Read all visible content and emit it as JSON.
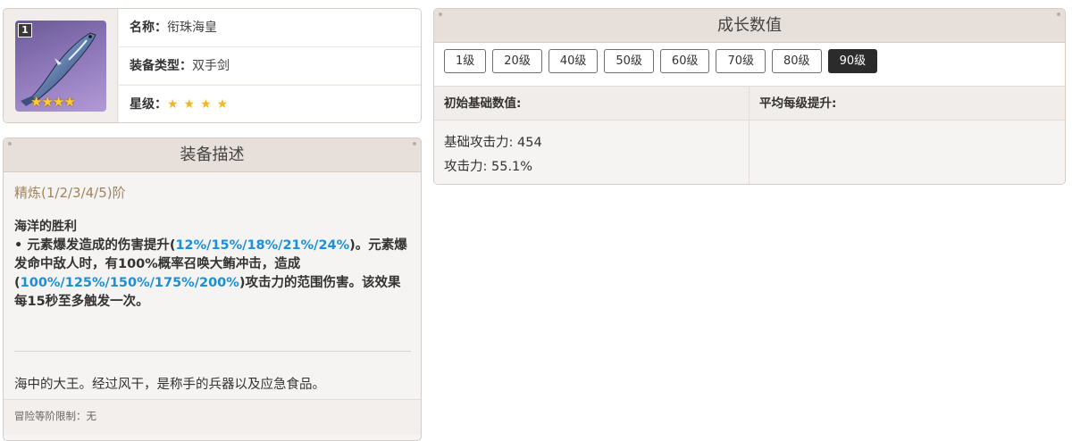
{
  "weapon": {
    "refine_badge": "1",
    "stars_icon": "★★★★",
    "name_label": "名称：",
    "name": "衔珠海皇",
    "type_label": "装备类型：",
    "type": "双手剑",
    "star_label": "星级：",
    "stars": "★★★★",
    "rarity": 4
  },
  "description": {
    "header": "装备描述",
    "refine": "精炼(1/2/3/4/5)阶",
    "skill_title": "海洋的胜利",
    "skill_parts": {
      "p1": " • 元素爆发造成的伤害提升(",
      "b1": "12%/15%/18%/21%/24%",
      "p2": ")。元素爆发命中敌人时，有100%概率召唤大鲔冲击，造成(",
      "b2": "100%/125%/150%/175%/200%",
      "p3": ")攻击力的范围伤害。该效果每15秒至多触发一次。"
    },
    "lore": "海中的大王。经过风干，是称手的兵器以及应急食品。",
    "limit": "冒险等阶限制：无"
  },
  "growth": {
    "header": "成长数值",
    "levels": [
      "1级",
      "20级",
      "40级",
      "50级",
      "60级",
      "70级",
      "80级",
      "90级"
    ],
    "selected_level": "90级",
    "col1_header": "初始基础数值:",
    "col2_header": "平均每级提升:",
    "stat1": "基础攻击力: 454",
    "stat2": "攻击力: 55.1%"
  },
  "colors": {
    "accent_blue": "#1b8fd8",
    "refine_gold": "#a2845c",
    "star_gold": "#f2b824",
    "selected_level_bg": "#2b2b2b"
  },
  "icons": {
    "weapon_icon": "fish-sword-icon",
    "star": "star-icon"
  }
}
